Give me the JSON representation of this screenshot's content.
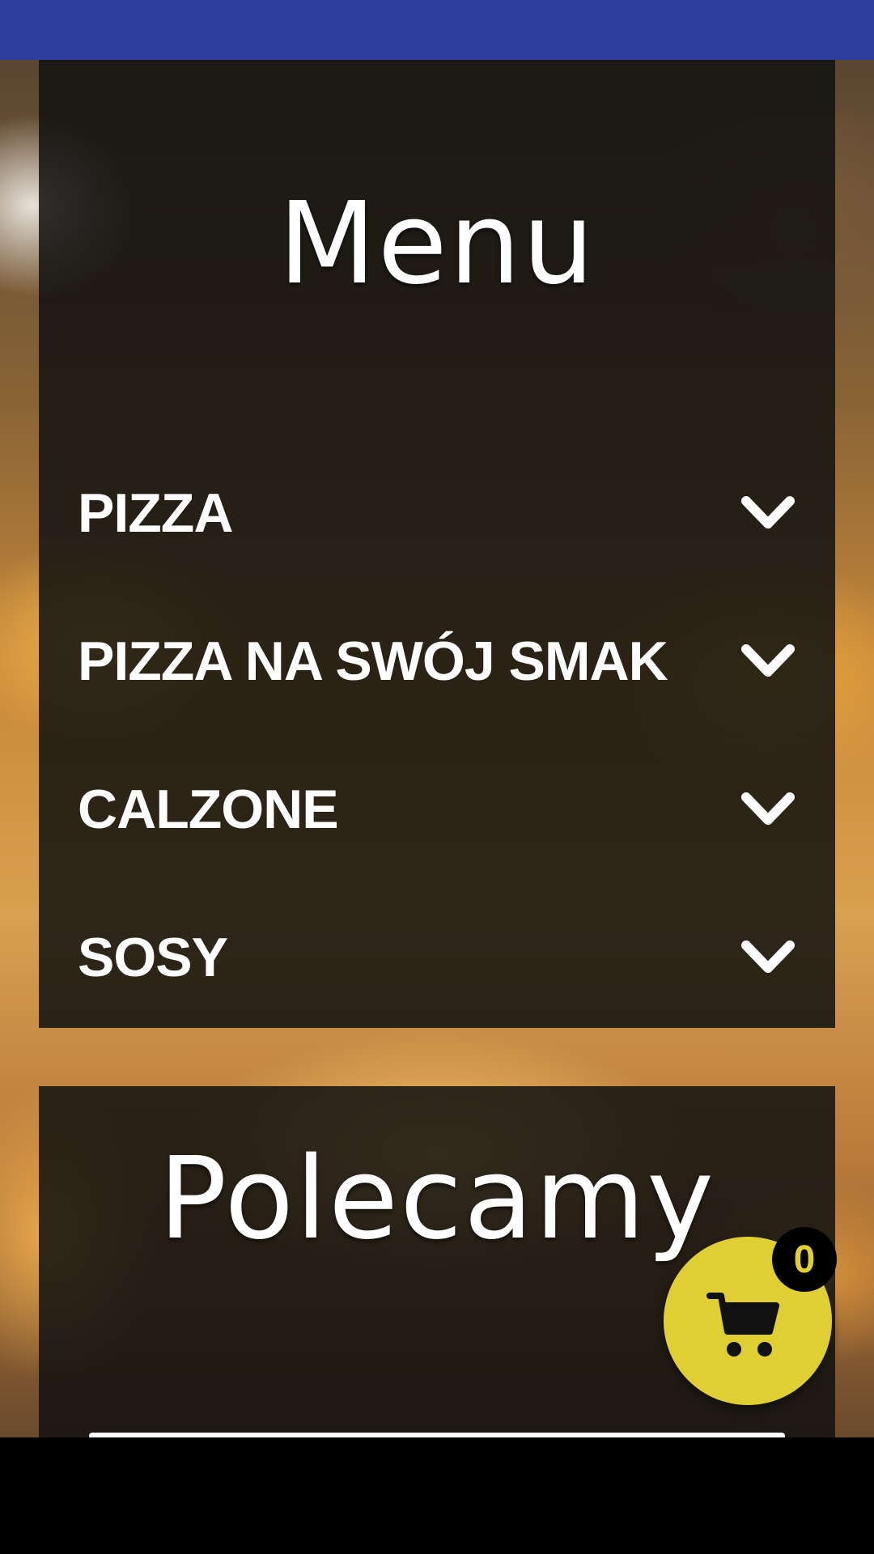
{
  "colors": {
    "status_bar": "#2f3e9e",
    "panel_overlay": "#121110",
    "accent_yellow": "#e0cf33",
    "text": "#ffffff",
    "nav_bar": "#000000"
  },
  "menu": {
    "title": "Menu",
    "items": [
      {
        "label": "PIZZA",
        "icon": "chevron-down-icon"
      },
      {
        "label": "PIZZA NA SWÓJ SMAK",
        "icon": "chevron-down-icon"
      },
      {
        "label": "CALZONE",
        "icon": "chevron-down-icon"
      },
      {
        "label": "SOSY",
        "icon": "chevron-down-icon"
      }
    ]
  },
  "recommended": {
    "title": "Polecamy"
  },
  "cart": {
    "icon": "cart-icon",
    "count": "0"
  }
}
